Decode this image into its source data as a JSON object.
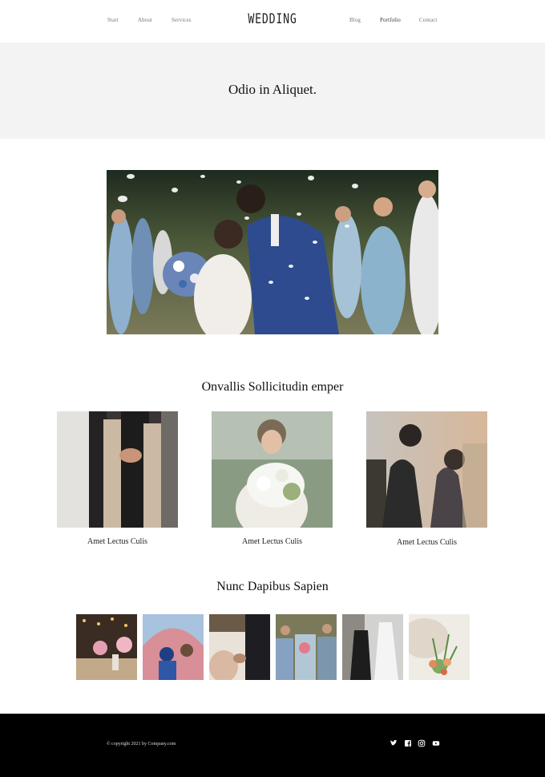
{
  "nav": {
    "left": [
      "Start",
      "About",
      "Services"
    ],
    "right": [
      "Blog",
      "Portfolio",
      "Contact"
    ],
    "active": "Portfolio"
  },
  "brand": {
    "logo": "WEDDING"
  },
  "hero": {
    "title": "Odio in Aliquet."
  },
  "sections": {
    "featured_title": "Onvallis Sollicitudin emper",
    "gallery_title": "Nunc Dapibus Sapien"
  },
  "cards": [
    {
      "caption": "Amet Lectus Culis"
    },
    {
      "caption": "Amet Lectus Culis"
    },
    {
      "caption": "Amet Lectus Culis"
    }
  ],
  "footer": {
    "copyright": "© copyright 2021 by Company.com",
    "social": [
      "twitter-icon",
      "facebook-icon",
      "instagram-icon",
      "youtube-icon"
    ]
  },
  "colors": {
    "footer_bg": "#000000",
    "hero_bg": "#f3f3f3"
  }
}
